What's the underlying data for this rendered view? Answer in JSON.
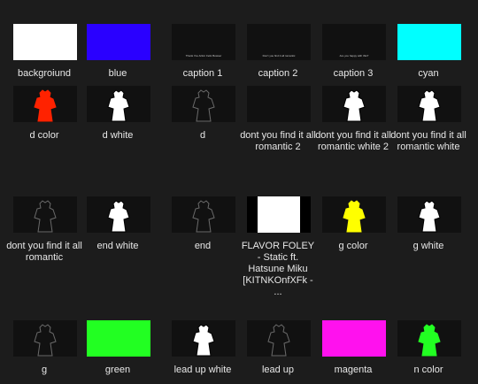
{
  "items": [
    {
      "label": "backgroiund",
      "thumb": {
        "kind": "solid",
        "color": "#ffffff"
      }
    },
    {
      "label": "blue",
      "thumb": {
        "kind": "solid",
        "color": "#2a00ff"
      }
    },
    {
      "label": "caption 1",
      "thumb": {
        "kind": "caption",
        "text": "Thank You Artist: Felix Bowser"
      }
    },
    {
      "label": "caption 2",
      "thumb": {
        "kind": "caption",
        "text": "Don't you find it all romantic"
      }
    },
    {
      "label": "caption 3",
      "thumb": {
        "kind": "caption",
        "text": "Are you happy with this?"
      }
    },
    {
      "label": "cyan",
      "thumb": {
        "kind": "solid",
        "color": "#00ffff"
      }
    },
    {
      "label": "d color",
      "thumb": {
        "kind": "figure",
        "fill": "#ff2200",
        "stroke": "#ff2200"
      }
    },
    {
      "label": "d white",
      "thumb": {
        "kind": "figure",
        "fill": "#ffffff",
        "stroke": "#000000"
      }
    },
    {
      "label": "d",
      "thumb": {
        "kind": "figure",
        "fill": "#111111",
        "stroke": "#6a6a6a"
      }
    },
    {
      "label": "dont you find it all romantic 2",
      "thumb": {
        "kind": "empty"
      }
    },
    {
      "label": "dont you find it all romantic white 2",
      "thumb": {
        "kind": "figure",
        "fill": "#ffffff",
        "stroke": "#000000"
      }
    },
    {
      "label": "dont you find it all romantic white",
      "thumb": {
        "kind": "figure",
        "fill": "#ffffff",
        "stroke": "#000000"
      }
    },
    {
      "label": "dont you find it all romantic",
      "thumb": {
        "kind": "figure",
        "fill": "#111111",
        "stroke": "#6a6a6a"
      }
    },
    {
      "label": "end white",
      "thumb": {
        "kind": "figure",
        "fill": "#ffffff",
        "stroke": "#000000"
      }
    },
    {
      "label": "end",
      "thumb": {
        "kind": "figure",
        "fill": "#111111",
        "stroke": "#6a6a6a"
      }
    },
    {
      "label": "FLAVOR FOLEY - Static ft. Hatsune Miku [KITNKOnfXFk - ...",
      "thumb": {
        "kind": "bars"
      }
    },
    {
      "label": "g color",
      "thumb": {
        "kind": "figure",
        "fill": "#ffff00",
        "stroke": "#ffff00"
      }
    },
    {
      "label": "g white",
      "thumb": {
        "kind": "figure",
        "fill": "#ffffff",
        "stroke": "#000000"
      }
    },
    {
      "label": "g",
      "thumb": {
        "kind": "figure",
        "fill": "#111111",
        "stroke": "#6a6a6a"
      }
    },
    {
      "label": "green",
      "thumb": {
        "kind": "solid",
        "color": "#22ff22"
      }
    },
    {
      "label": "lead up white",
      "thumb": {
        "kind": "figure",
        "fill": "#ffffff",
        "stroke": "#000000"
      }
    },
    {
      "label": "lead up",
      "thumb": {
        "kind": "figure",
        "fill": "#111111",
        "stroke": "#6a6a6a"
      }
    },
    {
      "label": "magenta",
      "thumb": {
        "kind": "solid",
        "color": "#ff11ee"
      }
    },
    {
      "label": "n color",
      "thumb": {
        "kind": "figure",
        "fill": "#22ff22",
        "stroke": "#22ff22"
      }
    }
  ]
}
